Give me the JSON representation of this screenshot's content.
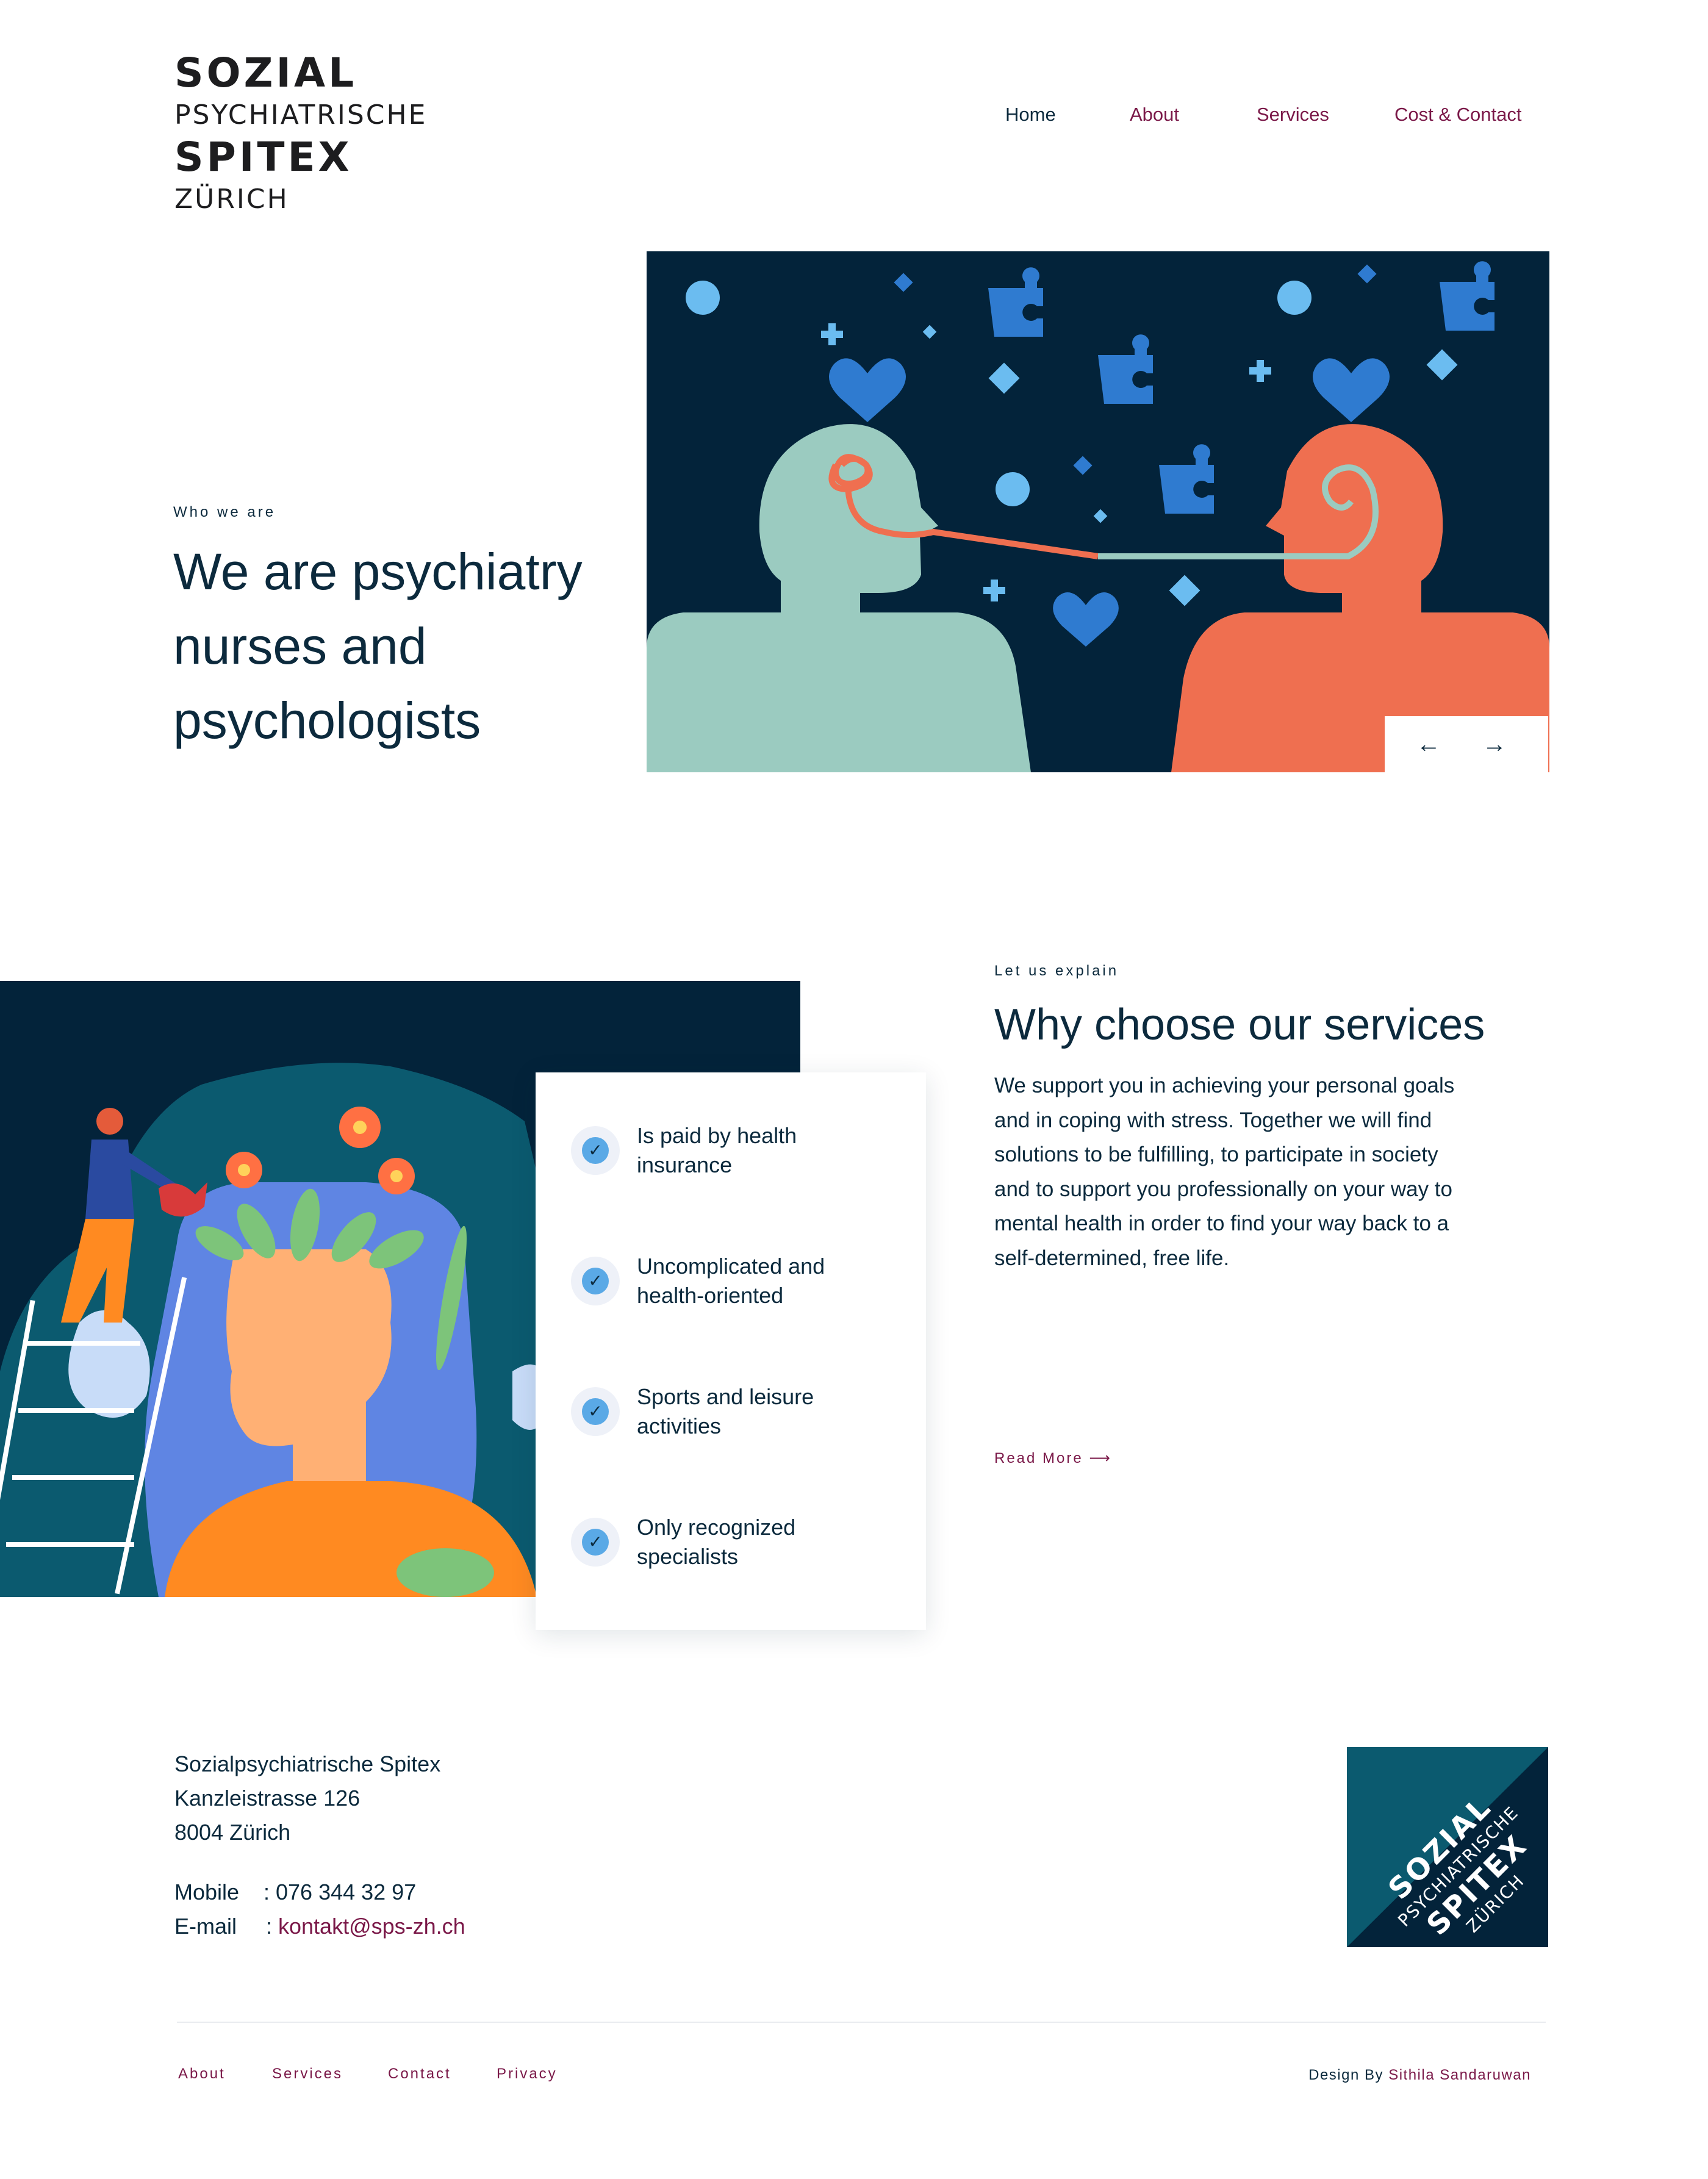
{
  "logo": {
    "line1": "SOZIAL",
    "line2": "PSYCHIATRISCHE",
    "line3": "SPITEX",
    "line4": "ZÜRICH"
  },
  "nav": {
    "items": [
      {
        "label": "Home",
        "active": true
      },
      {
        "label": "About",
        "active": false
      },
      {
        "label": "Services",
        "active": false
      },
      {
        "label": "Cost & Contact",
        "active": false
      }
    ]
  },
  "hero": {
    "eyebrow": "Who we are",
    "title": "We are psychiatry nurses and psychologists",
    "slider_prev_icon": "arrow-left-icon",
    "slider_next_icon": "arrow-right-icon",
    "slider_prev": "←",
    "slider_next": "→"
  },
  "services": {
    "eyebrow": "Let us explain",
    "title": "Why choose our services",
    "body": "We support you in achieving your personal goals and in coping with stress. Together we will find solutions to be fulfilling, to participate in society and to support you professionally on your way to mental health in order to find your way back to a self-determined, free life.",
    "read_more": "Read More ⟶",
    "features": [
      {
        "label": "Is paid by health insurance",
        "icon": "check-icon"
      },
      {
        "label": "Uncomplicated and health-oriented",
        "icon": "check-icon"
      },
      {
        "label": "Sports and leisure activities",
        "icon": "check-icon"
      },
      {
        "label": "Only recognized specialists",
        "icon": "check-icon"
      }
    ],
    "check_glyph": "✓"
  },
  "footer": {
    "address": [
      "Sozialpsychiatrische Spitex",
      "Kanzleistrasse 126",
      "8004 Zürich"
    ],
    "mobile_label": "Mobile",
    "mobile_value": ": 076 344 32 97",
    "email_label": "E-mail",
    "email_sep": ": ",
    "email_value": "kontakt@sps-zh.ch",
    "links": [
      "About",
      "Services",
      "Contact",
      "Privacy"
    ],
    "credit_prefix": "Design By",
    "credit_author": "Sithila Sandaruwan"
  },
  "colors": {
    "navy": "#03233a",
    "text": "#0c2a3d",
    "accent": "#7a1848",
    "teal": "#0b5a6f",
    "mint": "#9bcbc0",
    "coral": "#ef6f50"
  }
}
